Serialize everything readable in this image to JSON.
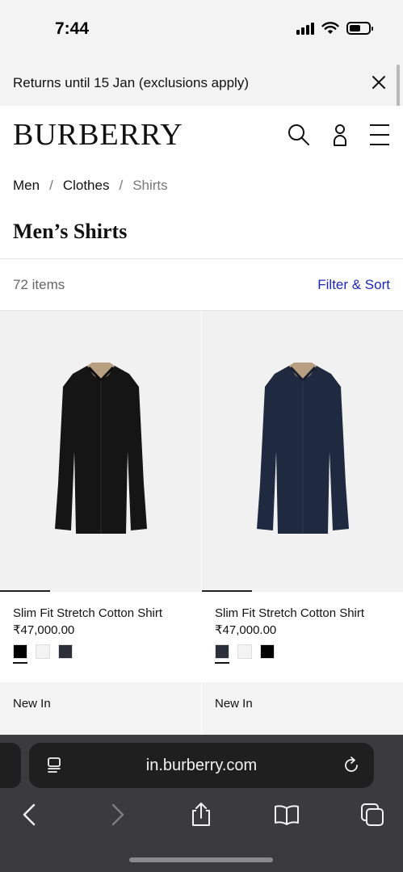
{
  "status_bar": {
    "time": "7:44"
  },
  "banner": {
    "text": "Returns until 15 Jan (exclusions apply)"
  },
  "header": {
    "logo": "BURBERRY"
  },
  "breadcrumb": {
    "items": [
      "Men",
      "Clothes",
      "Shirts"
    ],
    "separator": "/"
  },
  "page_title": "Men’s Shirts",
  "results": {
    "count": "72 items",
    "filter_label": "Filter & Sort"
  },
  "products": [
    {
      "name": "Slim Fit Stretch Cotton Shirt",
      "price": "₹47,000.00",
      "image_color": "#151515",
      "swatches": [
        "#000000",
        "#f3f3f3",
        "#2a2f3a"
      ],
      "selected_swatch": 0,
      "tag": "New In"
    },
    {
      "name": "Slim Fit Stretch Cotton Shirt",
      "price": "₹47,000.00",
      "image_color": "#1f2a40",
      "swatches": [
        "#2a2f3a",
        "#f3f3f3",
        "#000000"
      ],
      "selected_swatch": 0,
      "tag": "New In"
    }
  ],
  "browser": {
    "url": "in.burberry.com"
  },
  "colors": {
    "accent_link": "#1a27b3",
    "chrome_bg": "#3b3b3d"
  }
}
